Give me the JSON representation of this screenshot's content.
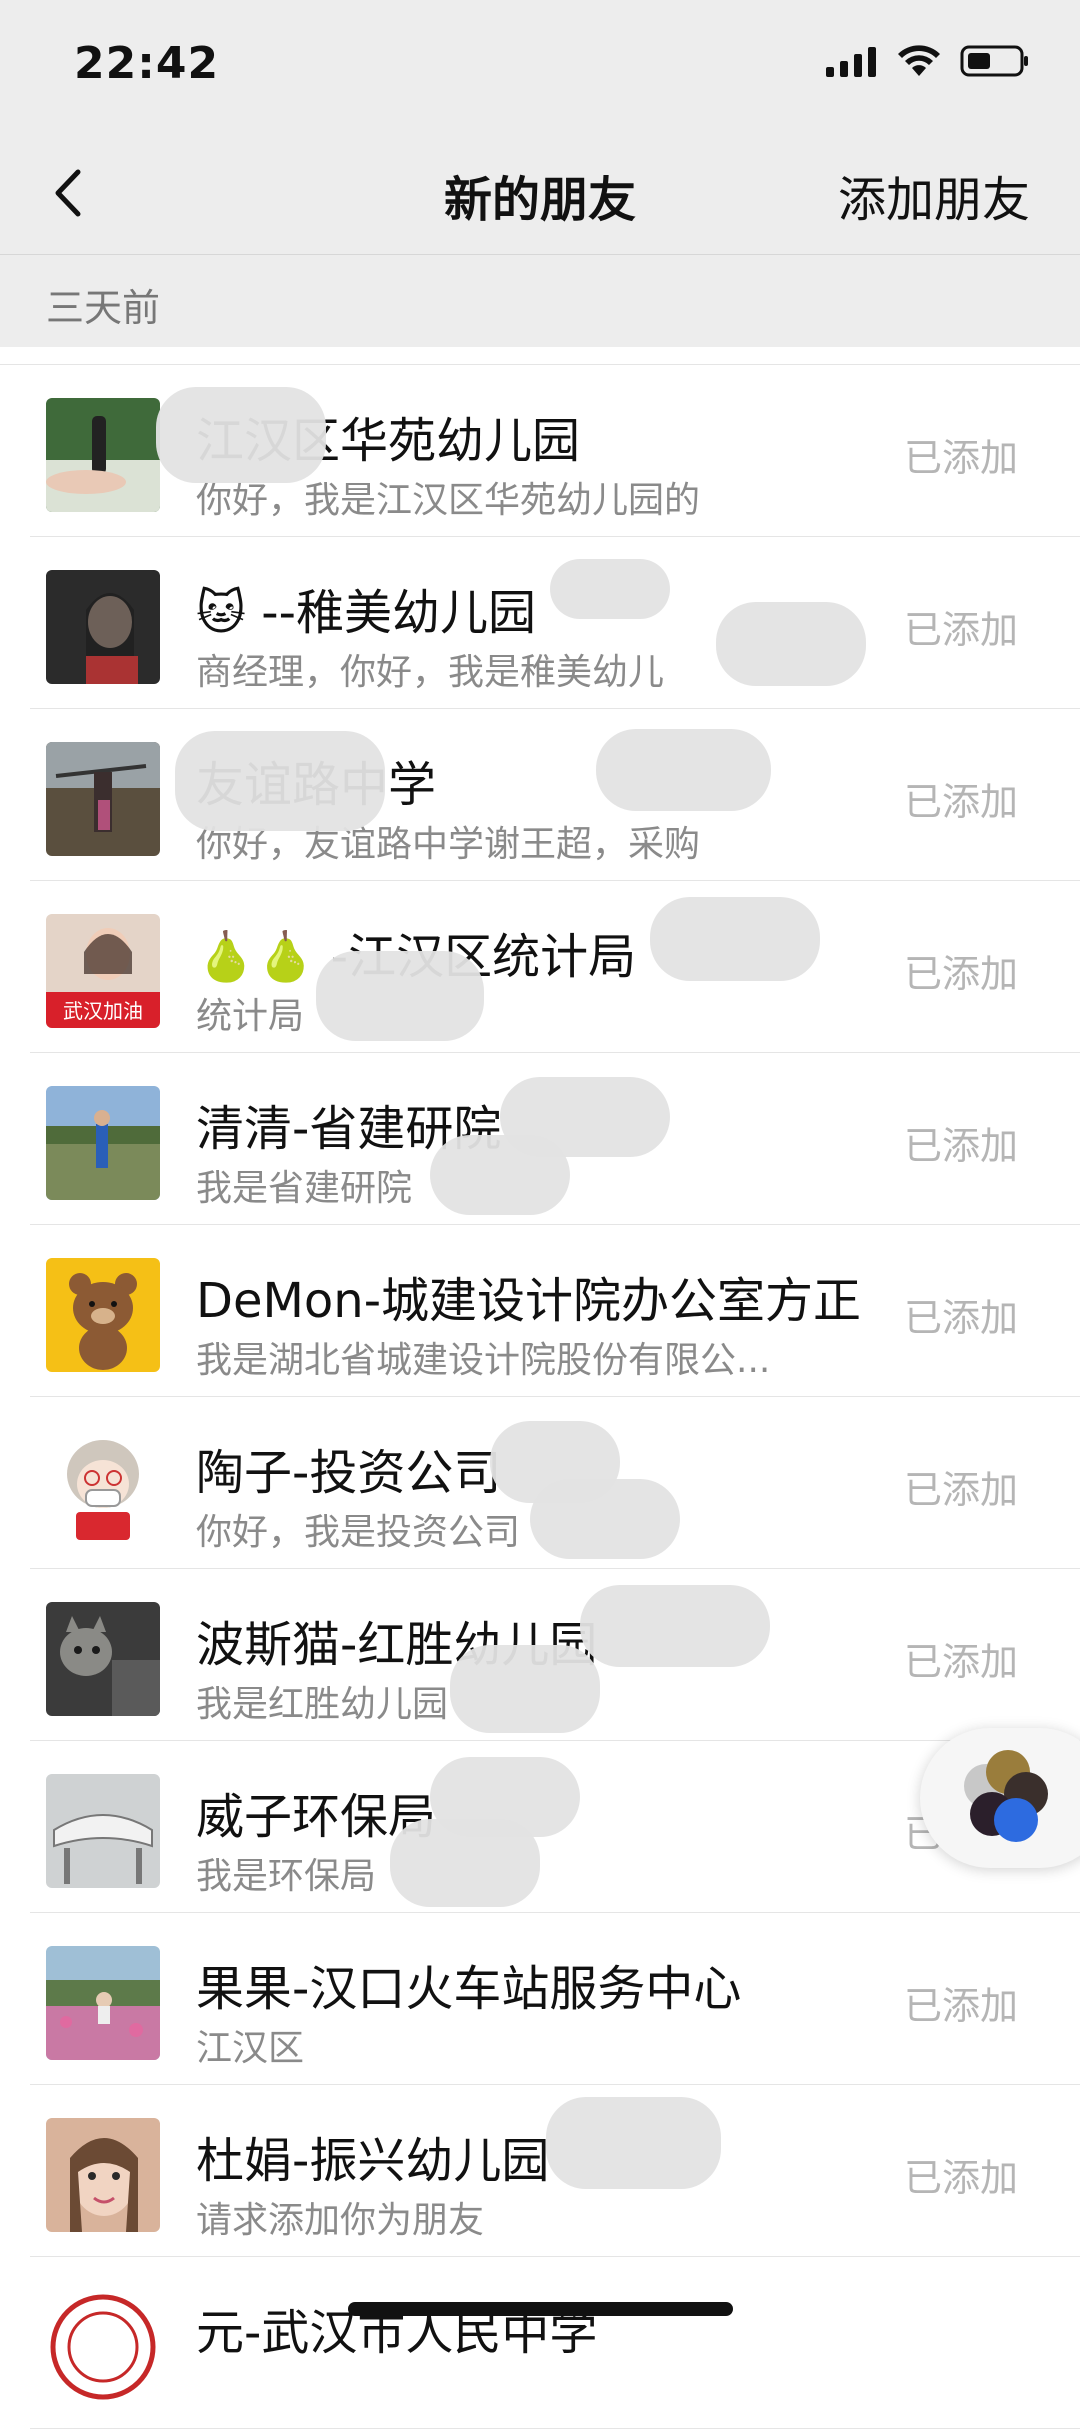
{
  "status_bar": {
    "time": "22:42"
  },
  "nav": {
    "title": "新的朋友",
    "action": "添加朋友"
  },
  "section": {
    "label": "三天前"
  },
  "contacts": [
    {
      "name": "江汉区华苑幼儿园",
      "message": "你好，我是江汉区华苑幼儿园的",
      "status": "已添加"
    },
    {
      "name": "🐱 --稚美幼儿园",
      "message": "商经理，你好，我是稚美幼儿",
      "status": "已添加"
    },
    {
      "name": "友谊路中学",
      "message": "你好，友谊路中学谢王超，采购",
      "status": "已添加"
    },
    {
      "name": "🍐🍐 -江汉区统计局",
      "message": "统计局",
      "status": "已添加",
      "avatar_caption": "武汉加油"
    },
    {
      "name": "清清-省建研院",
      "message": "我是省建研院",
      "status": "已添加"
    },
    {
      "name": "DeMon-城建设计院办公室方正",
      "message": "我是湖北省城建设计院股份有限公...",
      "status": "已添加"
    },
    {
      "name": "陶子-投资公司",
      "message": "你好，我是投资公司",
      "status": "已添加"
    },
    {
      "name": "波斯猫-红胜幼儿园",
      "message": "我是红胜幼儿园",
      "status": "已添加"
    },
    {
      "name": "威子环保局",
      "message": "我是环保局",
      "status": "已添加"
    },
    {
      "name": "果果-汉口火车站服务中心",
      "message": "江汉区",
      "status": "已添加"
    },
    {
      "name": "杜娟-振兴幼儿园",
      "message": "请求添加你为朋友",
      "status": "已添加"
    },
    {
      "name": "元-武汉市人民中学",
      "message": "",
      "status": ""
    }
  ],
  "colors": {
    "nav_bg": "#ededed",
    "added_status": "#b5b5b5",
    "message_text": "#8a8a8a"
  }
}
